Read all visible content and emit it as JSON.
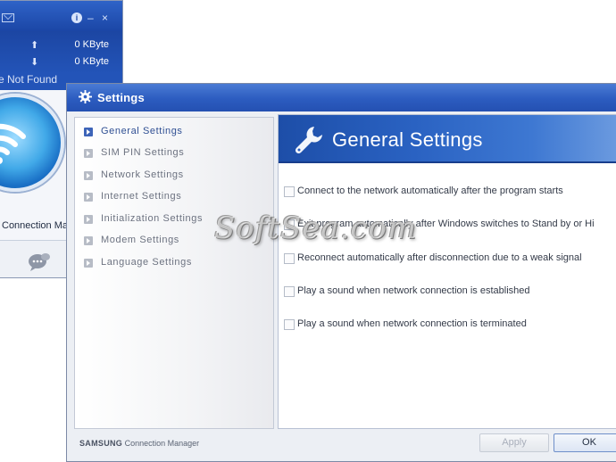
{
  "mini_window": {
    "upload_value": "0 KByte",
    "download_value": "0 KByte",
    "status_text": "e Not Found",
    "app_label": "Connection Ma",
    "icons": [
      "envelope-icon",
      "info-icon",
      "minimize-icon",
      "close-icon",
      "upload-arrow-icon",
      "download-arrow-icon",
      "wifi-icon",
      "chat-icon"
    ],
    "minimize_glyph": "–",
    "close_glyph": "×",
    "info_glyph": "i",
    "up_glyph": "⬆",
    "down_glyph": "⬇"
  },
  "settings": {
    "title": "Settings",
    "nav_items": [
      {
        "label": "General Settings",
        "active": true
      },
      {
        "label": "SIM PIN Settings",
        "active": false
      },
      {
        "label": "Network Settings",
        "active": false
      },
      {
        "label": "Internet Settings",
        "active": false
      },
      {
        "label": "Initialization Settings",
        "active": false
      },
      {
        "label": "Modem Settings",
        "active": false
      },
      {
        "label": "Language Settings",
        "active": false
      }
    ],
    "panel_title": "General Settings",
    "options": [
      {
        "label": "Connect to the network automatically after the program starts",
        "checked": false
      },
      {
        "label": "Exit program automatically after Windows switches to Stand by or Hi",
        "checked": false
      },
      {
        "label": "Reconnect automatically after disconnection due to a weak signal",
        "checked": false
      },
      {
        "label": "Play a sound when network connection is established",
        "checked": false
      },
      {
        "label": "Play a sound when network connection is terminated",
        "checked": false
      }
    ],
    "footer_brand": "SAMSUNG",
    "footer_product": "Connection Manager",
    "apply_label": "Apply",
    "ok_label": "OK",
    "colors": {
      "accent": "#2a5fc0",
      "title_bar": "#2c5cc0",
      "active_nav": "#2f4f93"
    }
  },
  "watermark": "SoftSea.com"
}
